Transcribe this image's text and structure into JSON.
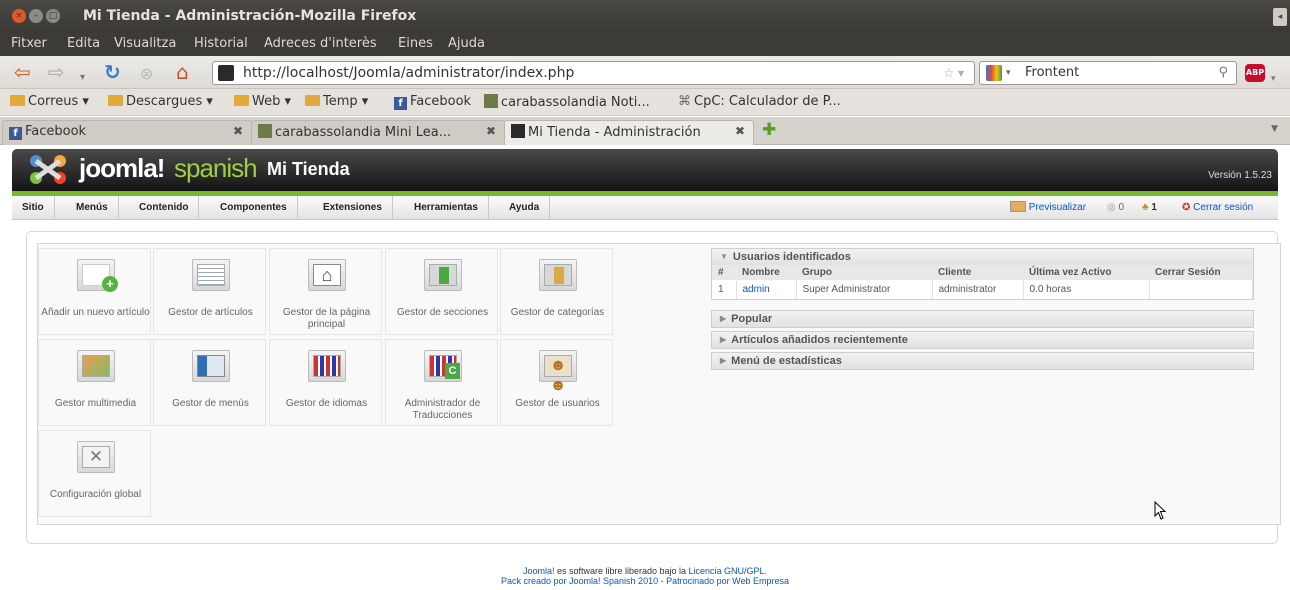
{
  "window": {
    "title": "Mi Tienda - Administración-Mozilla Firefox"
  },
  "menu": [
    "Fitxer",
    "Edita",
    "Visualitza",
    "Historial",
    "Adreces d'interès",
    "Eines",
    "Ajuda"
  ],
  "nav": {
    "url": "http://localhost/Joomla/administrator/index.php",
    "search_value": "Frontent"
  },
  "bookmarks": [
    "Correus",
    "Descargues",
    "Web",
    "Temp",
    "Facebook",
    "carabassolandia Noti...",
    "CpC: Calculador de P..."
  ],
  "tabs": [
    "Facebook",
    "carabassolandia Mini Lea...",
    "Mi Tienda - Administración"
  ],
  "joomla": {
    "brand": "joomla!",
    "brand_suffix": "spanish",
    "site_name": "Mi Tienda",
    "version": "Versión 1.5.23",
    "menu": [
      "Sitio",
      "Menús",
      "Contenido",
      "Componentes",
      "Extensiones",
      "Herramientas",
      "Ayuda"
    ],
    "preview": "Previsualizar",
    "messages_count": "0",
    "users_online": "1",
    "logout": "Cerrar sesión"
  },
  "icons": [
    {
      "label": "Añadir un nuevo artículo",
      "icon": "add-article-icon"
    },
    {
      "label": "Gestor de artículos",
      "icon": "article-manager-icon"
    },
    {
      "label": "Gestor de la página principal",
      "icon": "frontpage-manager-icon"
    },
    {
      "label": "Gestor de secciones",
      "icon": "section-manager-icon"
    },
    {
      "label": "Gestor de categorías",
      "icon": "category-manager-icon"
    },
    {
      "label": "Gestor multimedia",
      "icon": "media-manager-icon"
    },
    {
      "label": "Gestor de menús",
      "icon": "menu-manager-icon"
    },
    {
      "label": "Gestor de idiomas",
      "icon": "language-manager-icon"
    },
    {
      "label": "Administrador de Traducciones",
      "icon": "translation-manager-icon"
    },
    {
      "label": "Gestor de usuarios",
      "icon": "user-manager-icon"
    },
    {
      "label": "Configuración global",
      "icon": "global-config-icon"
    }
  ],
  "users_panel": {
    "title": "Usuarios identificados",
    "columns": [
      "#",
      "Nombre",
      "Grupo",
      "Cliente",
      "Última vez Activo",
      "Cerrar Sesión"
    ],
    "rows": [
      {
        "num": "1",
        "name": "admin",
        "group": "Super Administrator",
        "client": "administrator",
        "last_active": "0.0 horas",
        "logout": ""
      }
    ]
  },
  "panels": [
    "Popular",
    "Artículos añadidos recientemente",
    "Menú de estadísticas"
  ],
  "footer": {
    "line1_link": "Joomla!",
    "line1_text": " es software libre liberado bajo la ",
    "line1_license": "Licencia GNU/GPL.",
    "line2_pack": "Pack creado por Joomla! Spanish 2010",
    "line2_sep": " - ",
    "line2_sponsor": "Patrocinado por Web Empresa"
  }
}
